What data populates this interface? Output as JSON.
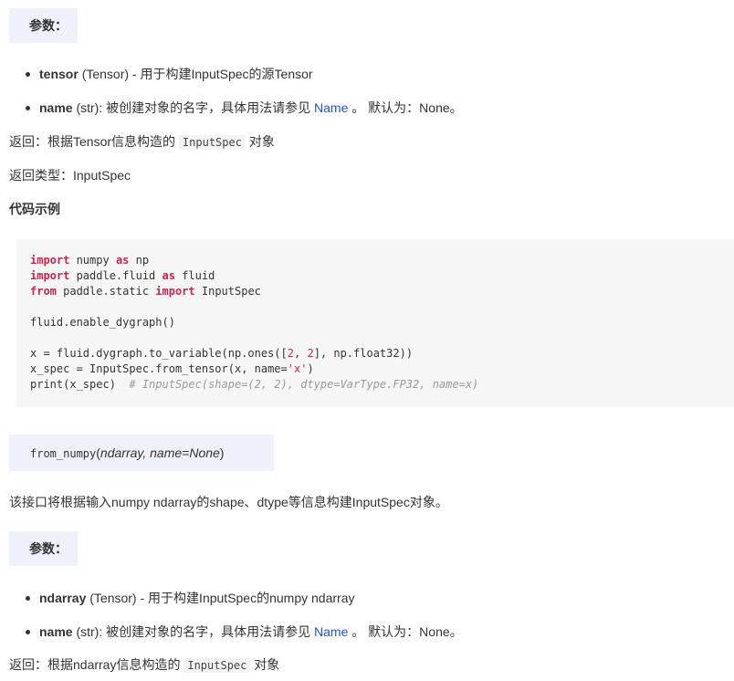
{
  "section1": {
    "param_label": "参数：",
    "params": [
      {
        "name": "tensor",
        "type": "(Tensor)",
        "desc": " - 用于构建InputSpec的源Tensor"
      },
      {
        "name": "name",
        "type": "(str)",
        "desc": ": 被创建对象的名字，具体用法请参见 ",
        "link": "Name",
        "after": " 。 默认为：None。"
      }
    ],
    "return_prefix": "返回：根据Tensor信息构造的 ",
    "return_code": "InputSpec",
    "return_suffix": " 对象",
    "return_type": "返回类型：InputSpec",
    "example_heading": "代码示例"
  },
  "code": {
    "l1_kw1": "import",
    "l1_a": " numpy ",
    "l1_kw2": "as",
    "l1_b": " np",
    "l2_kw1": "import",
    "l2_a": " paddle.fluid ",
    "l2_kw2": "as",
    "l2_b": " fluid",
    "l3_kw1": "from",
    "l3_a": " paddle.static ",
    "l3_kw2": "import",
    "l3_b": " InputSpec",
    "l5": "fluid.enable_dygraph()",
    "l7_a": "x = fluid.dygraph.to_variable(np.ones([",
    "l7_n1": "2",
    "l7_b": ", ",
    "l7_n2": "2",
    "l7_c": "], np.float32))",
    "l8_a": "x_spec = InputSpec.from_tensor(x, name=",
    "l8_s": "'x'",
    "l8_b": ")",
    "l9_a": "print(x_spec)  ",
    "l9_c": "# InputSpec(shape=(2, 2), dtype=VarType.FP32, name=x)"
  },
  "signature": {
    "name": "from_numpy",
    "open": "(",
    "args": "ndarray, name=None",
    "close": ")"
  },
  "description": "该接口将根据输入numpy ndarray的shape、dtype等信息构建InputSpec对象。",
  "section2": {
    "param_label": "参数：",
    "params": [
      {
        "name": "ndarray",
        "type": "(Tensor)",
        "desc": " - 用于构建InputSpec的numpy ndarray"
      },
      {
        "name": "name",
        "type": "(str)",
        "desc": ": 被创建对象的名字，具体用法请参见 ",
        "link": "Name",
        "after": " 。 默认为：None。"
      }
    ],
    "return_prefix": "返回：根据ndarray信息构造的 ",
    "return_code": "InputSpec",
    "return_suffix": " 对象"
  }
}
